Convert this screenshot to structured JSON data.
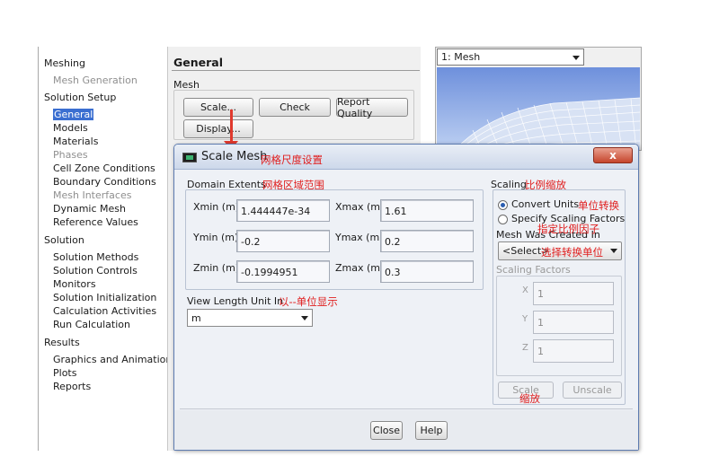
{
  "tree": {
    "items": [
      {
        "label": "Meshing",
        "level": 0,
        "state": "normal"
      },
      {
        "label": "Mesh Generation",
        "level": 1,
        "state": "disabled"
      },
      {
        "label": "Solution Setup",
        "level": 0,
        "state": "normal"
      },
      {
        "label": "General",
        "level": 1,
        "state": "selected"
      },
      {
        "label": "Models",
        "level": 1,
        "state": "normal"
      },
      {
        "label": "Materials",
        "level": 1,
        "state": "normal"
      },
      {
        "label": "Phases",
        "level": 1,
        "state": "disabled"
      },
      {
        "label": "Cell Zone Conditions",
        "level": 1,
        "state": "normal"
      },
      {
        "label": "Boundary Conditions",
        "level": 1,
        "state": "normal"
      },
      {
        "label": "Mesh Interfaces",
        "level": 1,
        "state": "disabled"
      },
      {
        "label": "Dynamic Mesh",
        "level": 1,
        "state": "normal"
      },
      {
        "label": "Reference Values",
        "level": 1,
        "state": "normal"
      },
      {
        "label": "Solution",
        "level": 0,
        "state": "normal"
      },
      {
        "label": "Solution Methods",
        "level": 1,
        "state": "normal"
      },
      {
        "label": "Solution Controls",
        "level": 1,
        "state": "normal"
      },
      {
        "label": "Monitors",
        "level": 1,
        "state": "normal"
      },
      {
        "label": "Solution Initialization",
        "level": 1,
        "state": "normal"
      },
      {
        "label": "Calculation Activities",
        "level": 1,
        "state": "normal"
      },
      {
        "label": "Run Calculation",
        "level": 1,
        "state": "normal"
      },
      {
        "label": "Results",
        "level": 0,
        "state": "normal"
      },
      {
        "label": "Graphics and Animations",
        "level": 1,
        "state": "normal"
      },
      {
        "label": "Plots",
        "level": 1,
        "state": "normal"
      },
      {
        "label": "Reports",
        "level": 1,
        "state": "normal"
      }
    ]
  },
  "general": {
    "title": "General",
    "mesh_label": "Mesh",
    "scale_button": "Scale...",
    "check_button": "Check",
    "report_quality_button": "Report Quality",
    "display_button": "Display..."
  },
  "viewport": {
    "window_select": "1: Mesh"
  },
  "dialog": {
    "title": "Scale Mesh",
    "domain_extents_label": "Domain Extents",
    "xmin_label": "Xmin (m)",
    "xmin_value": "1.444447e-34",
    "xmax_label": "Xmax (m)",
    "xmax_value": "1.61",
    "ymin_label": "Ymin (m)",
    "ymin_value": "-0.2",
    "ymax_label": "Ymax (m)",
    "ymax_value": "0.2",
    "zmin_label": "Zmin (m)",
    "zmin_value": "-0.1994951",
    "zmax_label": "Zmax (m)",
    "zmax_value": "0.3",
    "view_length_label": "View Length Unit In",
    "view_length_value": "m",
    "scaling_label": "Scaling",
    "convert_units_label": "Convert Units",
    "specify_factors_label": "Specify Scaling Factors",
    "mesh_created_label": "Mesh Was Created In",
    "mesh_created_value": "<Select>",
    "scaling_factors_label": "Scaling Factors",
    "x_label": "X",
    "x_value": "1",
    "y_label": "Y",
    "y_value": "1",
    "z_label": "Z",
    "z_value": "1",
    "scale_button": "Scale",
    "unscale_button": "Unscale",
    "close_button": "Close",
    "help_button": "Help",
    "close_icon_label": "x"
  },
  "annotations": {
    "title_note": "网格尺度设置",
    "domain_note": "网格区域范围",
    "scaling_note": "比例缩放",
    "convert_note": "单位转换",
    "specify_note": "指定比例因子",
    "select_note": "选择转换单位",
    "view_note": "以--单位显示",
    "scale_note": "缩放"
  },
  "colors": {
    "annotation": "#e01e1e",
    "selection": "#3b6fd1",
    "mesh_background": "#6e90dc"
  }
}
